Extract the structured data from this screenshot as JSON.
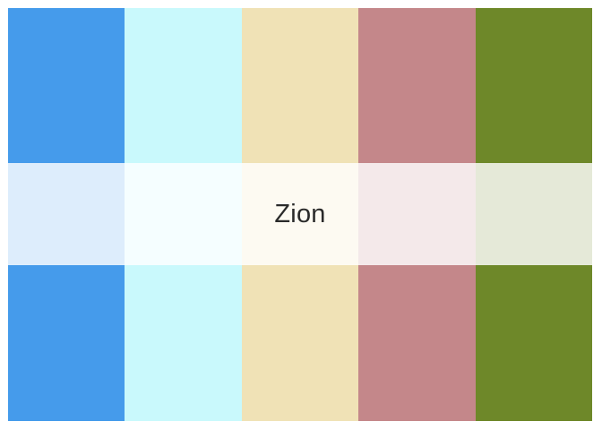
{
  "palette": {
    "name": "Zion",
    "colors": [
      "#459BEB",
      "#C9F9FC",
      "#F0E2B6",
      "#C4878A",
      "#6E8829"
    ]
  }
}
